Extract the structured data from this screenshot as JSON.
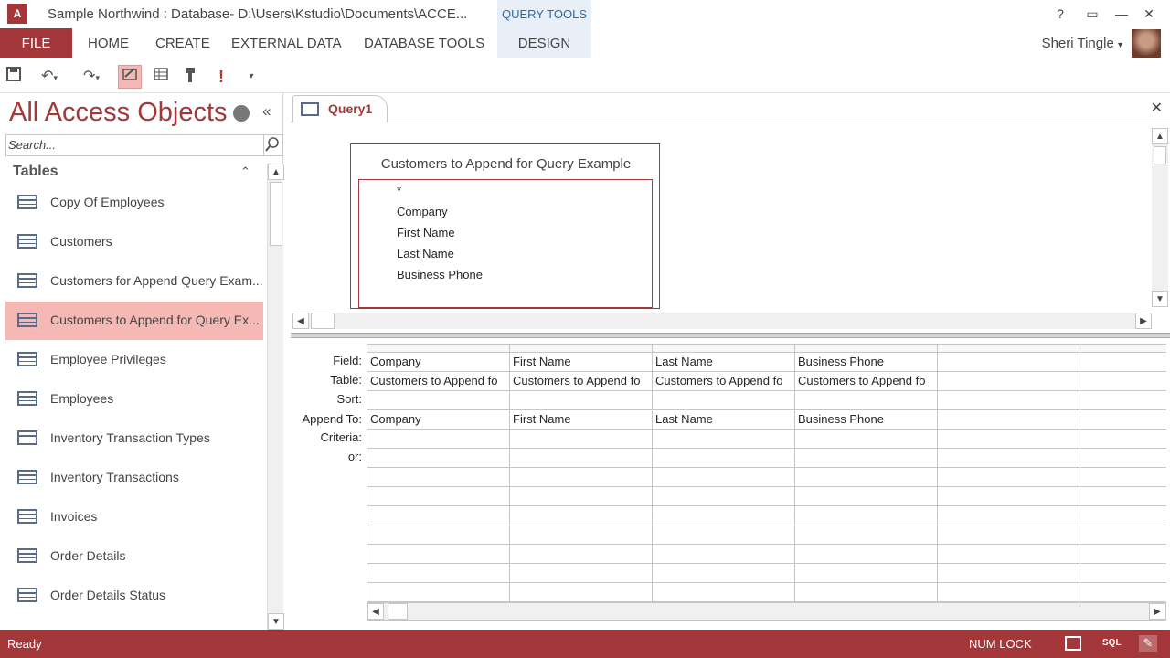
{
  "window": {
    "title": "Sample Northwind : Database- D:\\Users\\Kstudio\\Documents\\ACCE...",
    "context_tab": "QUERY TOOLS",
    "help": "?",
    "minimize": "—",
    "restore": "❐",
    "close": "✕"
  },
  "ribbon": {
    "file": "FILE",
    "tabs": [
      "HOME",
      "CREATE",
      "EXTERNAL DATA",
      "DATABASE TOOLS",
      "DESIGN"
    ],
    "user": "Sheri Tingle",
    "accent": "#a4373a"
  },
  "qat": {
    "save_icon": "save-icon",
    "undo_icon": "undo-icon",
    "redo_icon": "redo-icon",
    "design_icon": "design-view-icon",
    "datasheet_icon": "datasheet-icon",
    "pin_icon": "pin-icon",
    "run_icon": "run-icon",
    "more_icon": "customize-qat-icon"
  },
  "nav": {
    "title": "All Access Objects",
    "search_placeholder": "Search...",
    "group": "Tables",
    "items": [
      {
        "label": "Copy Of Employees"
      },
      {
        "label": "Customers"
      },
      {
        "label": "Customers for Append Query Exam..."
      },
      {
        "label": "Customers to Append for Query Ex..."
      },
      {
        "label": "Employee Privileges"
      },
      {
        "label": "Employees"
      },
      {
        "label": "Inventory Transaction Types"
      },
      {
        "label": "Inventory Transactions"
      },
      {
        "label": "Invoices"
      },
      {
        "label": "Order Details"
      },
      {
        "label": "Order Details Status"
      }
    ]
  },
  "document": {
    "tab": "Query1",
    "close": "✕",
    "field_list": {
      "title": "Customers to Append for Query Example",
      "fields": [
        "*",
        "Company",
        "First Name",
        "Last Name",
        "Business Phone"
      ]
    },
    "grid": {
      "row_labels": [
        "Field:",
        "Table:",
        "Sort:",
        "Append To:",
        "Criteria:",
        "or:"
      ],
      "columns": [
        {
          "field": "Company",
          "table": "Customers to Append fo",
          "sort": "",
          "append_to": "Company"
        },
        {
          "field": "First Name",
          "table": "Customers to Append fo",
          "sort": "",
          "append_to": "First Name"
        },
        {
          "field": "Last Name",
          "table": "Customers to Append fo",
          "sort": "",
          "append_to": "Last Name"
        },
        {
          "field": "Business Phone",
          "table": "Customers to Append fo",
          "sort": "",
          "append_to": "Business Phone"
        },
        {
          "field": "",
          "table": "",
          "sort": "",
          "append_to": ""
        },
        {
          "field": "",
          "table": "",
          "sort": "",
          "append_to": ""
        }
      ]
    }
  },
  "status": {
    "text": "Ready",
    "num_lock": "NUM LOCK",
    "sql": "SQL"
  }
}
